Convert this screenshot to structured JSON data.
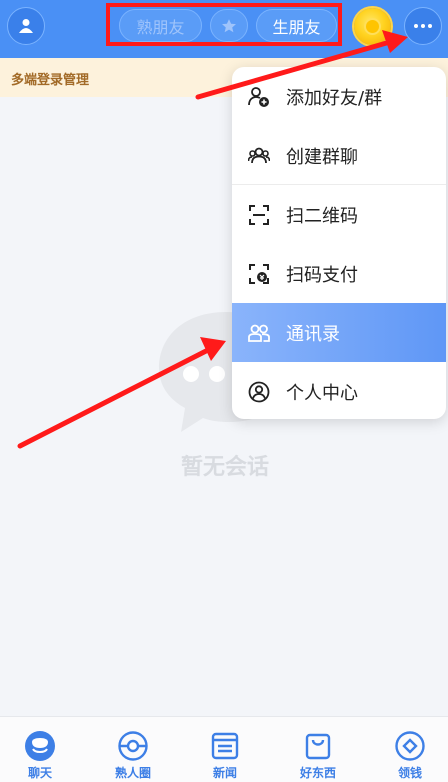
{
  "header": {
    "tabs": [
      {
        "label": "熟朋友",
        "state": "inactive"
      },
      {
        "icon": "star-icon"
      },
      {
        "label": "生朋友",
        "state": "active"
      }
    ]
  },
  "notice": {
    "text": "多端登录管理"
  },
  "empty_state": {
    "text": "暂无会话"
  },
  "menu": {
    "items": [
      {
        "label": "添加好友/群",
        "icon": "add-user-icon"
      },
      {
        "label": "创建群聊",
        "icon": "group-icon"
      },
      {
        "label": "扫二维码",
        "icon": "scan-icon"
      },
      {
        "label": "扫码支付",
        "icon": "scan-pay-icon"
      },
      {
        "label": "通讯录",
        "icon": "contacts-icon",
        "active": true
      },
      {
        "label": "个人中心",
        "icon": "profile-icon"
      }
    ]
  },
  "tabbar": {
    "items": [
      {
        "label": "聊天",
        "icon": "chat-icon"
      },
      {
        "label": "熟人圈",
        "icon": "moments-icon"
      },
      {
        "label": "新闻",
        "icon": "news-icon"
      },
      {
        "label": "好东西",
        "icon": "shop-bag-icon"
      },
      {
        "label": "领钱",
        "icon": "money-icon"
      }
    ]
  },
  "colors": {
    "header": "#4a90f5",
    "highlight_box": "#ff1a1a",
    "arrow": "#ff1a1a",
    "accent": "#3d7fe6",
    "notice_bg": "#fdf2dc"
  }
}
